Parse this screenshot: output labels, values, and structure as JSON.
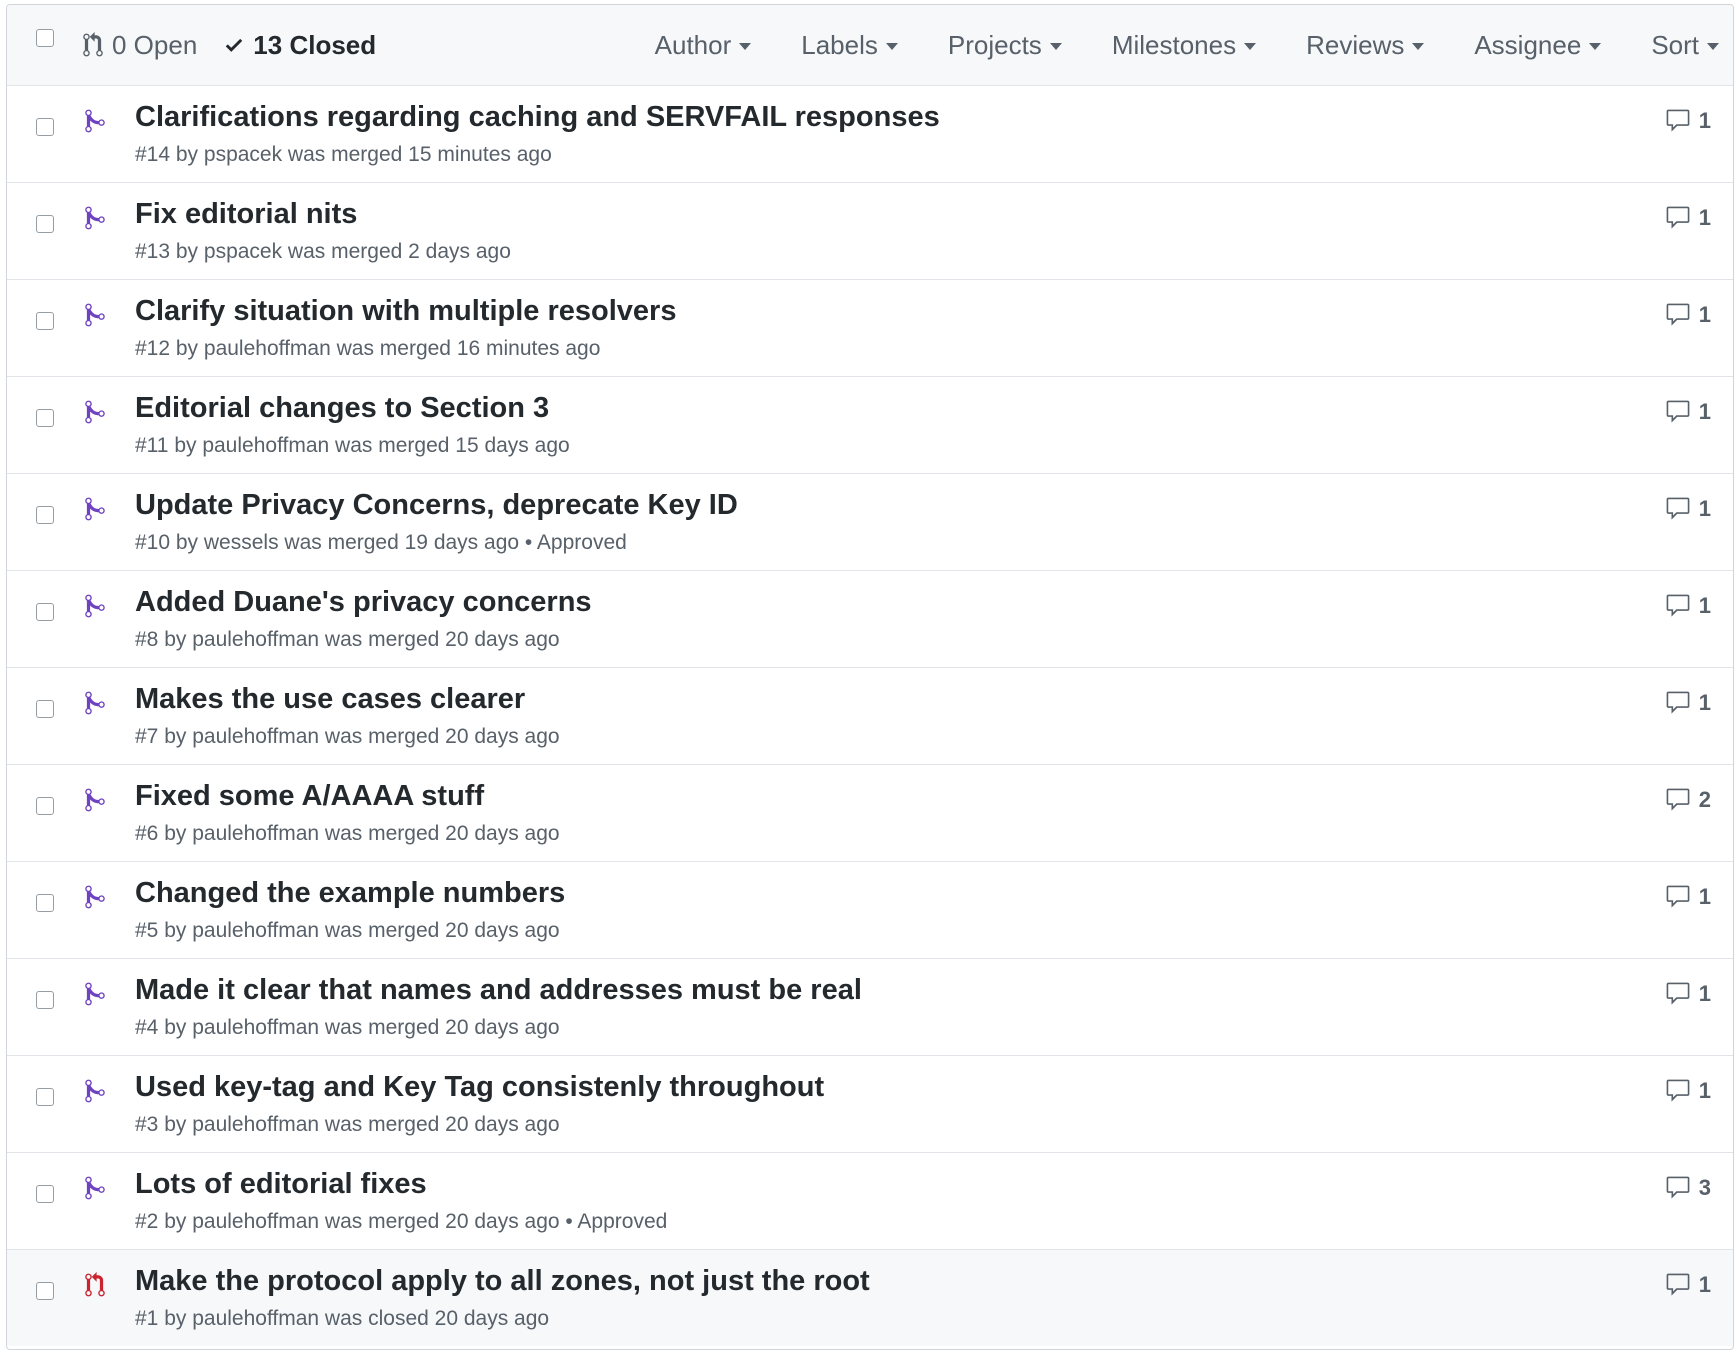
{
  "header": {
    "open_label": "0 Open",
    "closed_label": "13 Closed",
    "filters": [
      "Author",
      "Labels",
      "Projects",
      "Milestones",
      "Reviews",
      "Assignee",
      "Sort"
    ]
  },
  "pull_requests": [
    {
      "title": "Clarifications regarding caching and SERVFAIL responses",
      "meta": "#14 by pspacek was merged 15 minutes ago",
      "comments": "1",
      "state": "merged"
    },
    {
      "title": "Fix editorial nits",
      "meta": "#13 by pspacek was merged 2 days ago",
      "comments": "1",
      "state": "merged"
    },
    {
      "title": "Clarify situation with multiple resolvers",
      "meta": "#12 by paulehoffman was merged 16 minutes ago",
      "comments": "1",
      "state": "merged"
    },
    {
      "title": "Editorial changes to Section 3",
      "meta": "#11 by paulehoffman was merged 15 days ago",
      "comments": "1",
      "state": "merged"
    },
    {
      "title": "Update Privacy Concerns, deprecate Key ID",
      "meta": "#10 by wessels was merged 19 days ago • Approved",
      "comments": "1",
      "state": "merged"
    },
    {
      "title": "Added Duane's privacy concerns",
      "meta": "#8 by paulehoffman was merged 20 days ago",
      "comments": "1",
      "state": "merged"
    },
    {
      "title": "Makes the use cases clearer",
      "meta": "#7 by paulehoffman was merged 20 days ago",
      "comments": "1",
      "state": "merged"
    },
    {
      "title": "Fixed some A/AAAA stuff",
      "meta": "#6 by paulehoffman was merged 20 days ago",
      "comments": "2",
      "state": "merged"
    },
    {
      "title": "Changed the example numbers",
      "meta": "#5 by paulehoffman was merged 20 days ago",
      "comments": "1",
      "state": "merged"
    },
    {
      "title": "Made it clear that names and addresses must be real",
      "meta": "#4 by paulehoffman was merged 20 days ago",
      "comments": "1",
      "state": "merged"
    },
    {
      "title": "Used key-tag and Key Tag consistenly throughout",
      "meta": "#3 by paulehoffman was merged 20 days ago",
      "comments": "1",
      "state": "merged"
    },
    {
      "title": "Lots of editorial fixes",
      "meta": "#2 by paulehoffman was merged 20 days ago • Approved",
      "comments": "3",
      "state": "merged"
    },
    {
      "title": "Make the protocol apply to all zones, not just the root",
      "meta": "#1 by paulehoffman was closed 20 days ago",
      "comments": "1",
      "state": "closed"
    }
  ],
  "colors": {
    "merged": "#6f42c1",
    "closed": "#cb2431"
  }
}
